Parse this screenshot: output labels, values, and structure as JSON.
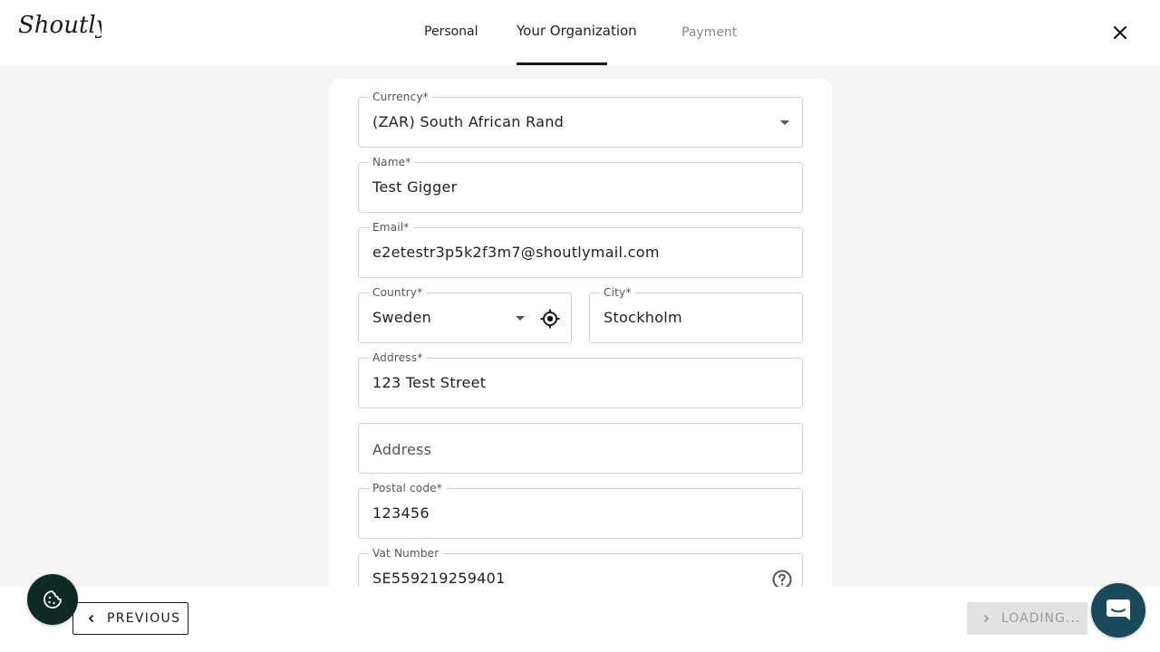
{
  "header": {
    "logo_text": "Shoutly",
    "tabs": [
      {
        "label": "Personal",
        "state": "completed"
      },
      {
        "label": "Your Organization",
        "state": "active"
      },
      {
        "label": "Payment",
        "state": "upcoming"
      }
    ],
    "close_icon": "close-icon"
  },
  "form": {
    "currency": {
      "label": "Currency",
      "required_mark": "*",
      "value": "(ZAR) South African Rand"
    },
    "name": {
      "label": "Name",
      "required_mark": "*",
      "value": "Test Gigger"
    },
    "email": {
      "label": "Email",
      "required_mark": "*",
      "value": "e2etestr3p5k2f3m7@shoutlymail.com"
    },
    "country": {
      "label": "Country",
      "required_mark": "*",
      "value": "Sweden"
    },
    "city": {
      "label": "City",
      "required_mark": "*",
      "value": "Stockholm"
    },
    "address": {
      "label": "Address",
      "required_mark": "*",
      "value": "123 Test Street"
    },
    "address2": {
      "placeholder": "Address"
    },
    "postal_code": {
      "label": "Postal code",
      "required_mark": "*",
      "value": "123456"
    },
    "vat_number": {
      "label": "Vat Number",
      "value": "SE559219259401"
    }
  },
  "footer": {
    "previous_label": "PREVIOUS",
    "next_label": "LOADING..."
  },
  "colors": {
    "accent": "#1a1a1a",
    "page_background": "#f5f5f5",
    "cookie_button": "#0d2a26",
    "chat_button": "#1a4a5a",
    "disabled_button": "#e2e2e2"
  },
  "icons": [
    "close-icon",
    "dropdown-caret-icon",
    "location-target-icon",
    "help-circle-icon",
    "chevron-left-icon",
    "chevron-right-icon",
    "cookie-icon",
    "chat-icon"
  ]
}
